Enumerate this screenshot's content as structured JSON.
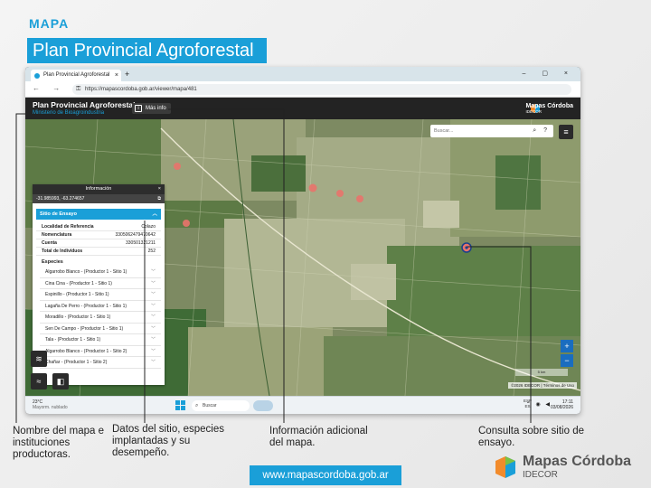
{
  "slide": {
    "header_tag": "MAPA",
    "title": "Plan Provincial Agroforestal",
    "footer_url": "www.mapascordoba.gob.ar",
    "brand_name": "Mapas Córdoba",
    "brand_sub": "IDECOR",
    "annotations": {
      "map_name": "Nombre del mapa e instituciones productoras.",
      "site_data": "Datos del sitio, especies implantadas y su desempeño.",
      "extra_info": "Información adicional del mapa.",
      "query": "Consulta sobre sitio de ensayo."
    }
  },
  "browser": {
    "tab_title": "Plan Provincial Agroforestal",
    "tab_close": "×",
    "new_tab": "+",
    "window_controls": "– ▢ ×",
    "nav": "← → ⟳",
    "url": "https://mapascordoba.gob.ar/viewer/mapa/481"
  },
  "app": {
    "title": "Plan Provincial Agroforestal",
    "subtitle": "Ministerio de Bioagroindustria",
    "more_info": "Más info",
    "logo_name": "Mapas Córdoba",
    "logo_sub": "IDECOR"
  },
  "map": {
    "search_placeholder": "Buscar...",
    "search_icons": "⌕ ?",
    "menu_icon": "≡",
    "layers_icon": "≋",
    "basemap_icon": "◧",
    "legend_icon": "≈",
    "zoom_in": "+",
    "zoom_out": "−",
    "scale": "5 km",
    "attribution": "©2026 IDECOR | Términos de Uso"
  },
  "panel": {
    "title": "Información",
    "close": "×",
    "coords": "-31.985993, -63.274657",
    "copy_icon": "⧉",
    "section_title": "Sitio de Ensayo",
    "section_chevron": "︿",
    "fields": [
      {
        "label": "Localidad de Referencia",
        "value": "Colazo"
      },
      {
        "label": "Nomenclatura",
        "value": "3305062479470642"
      },
      {
        "label": "Cuenta",
        "value": "330501321211"
      },
      {
        "label": "Total de Individuos",
        "value": "252"
      }
    ],
    "species_title": "Especies",
    "species": [
      "Algarrobo Blanco - (Productor 1 - Sitio 1)",
      "Cina Cina - (Productor 1 - Sitio 1)",
      "Espinillo - (Productor 1 - Sitio 1)",
      "Lagaña De Perro - (Productor 1 - Sitio 1)",
      "Moradillo - (Productor 1 - Sitio 1)",
      "Sen De Campo - (Productor 1 - Sitio 1)",
      "Tala - (Productor 1 - Sitio 1)",
      "Algarrobo Blanco - (Productor 1 - Sitio 2)",
      "Chañar - (Productor 1 - Sitio 2)"
    ],
    "item_chevron": "﹀"
  },
  "taskbar": {
    "weather_temp": "23°C",
    "weather_desc": "Mayorm. nublado",
    "search": "Buscar",
    "search_icon": "⌕",
    "tray_lang": "ESP",
    "tray_lang2": "ES",
    "tray_icons": "⌃ ◉ ◀",
    "time": "17:11",
    "date": "03/08/2026"
  }
}
